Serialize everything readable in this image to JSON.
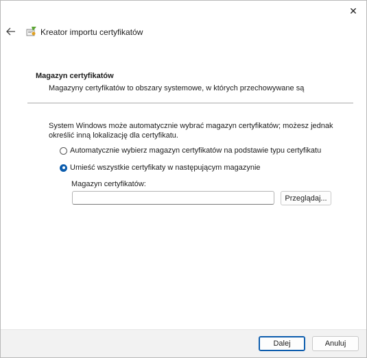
{
  "window": {
    "title": "Kreator importu certyfikatów",
    "close_icon": "✕",
    "back_icon": "←"
  },
  "section": {
    "title": "Magazyn certyfikatów",
    "description": "Magazyny certyfikatów to obszary systemowe, w których przechowywane są"
  },
  "intro": "System Windows może automatycznie wybrać magazyn certyfikatów; możesz jednak określić inną lokalizację dla certyfikatu.",
  "options": [
    {
      "label": "Automatycznie wybierz magazyn certyfikatów na podstawie typu certyfikatu",
      "checked": false
    },
    {
      "label": "Umieść wszystkie certyfikaty w następującym magazynie",
      "checked": true
    }
  ],
  "store": {
    "label": "Magazyn certyfikatów:",
    "value": "",
    "browse_label": "Przeglądaj..."
  },
  "footer": {
    "next_label": "Dalej",
    "cancel_label": "Anuluj"
  },
  "colors": {
    "accent": "#0b5cad"
  }
}
